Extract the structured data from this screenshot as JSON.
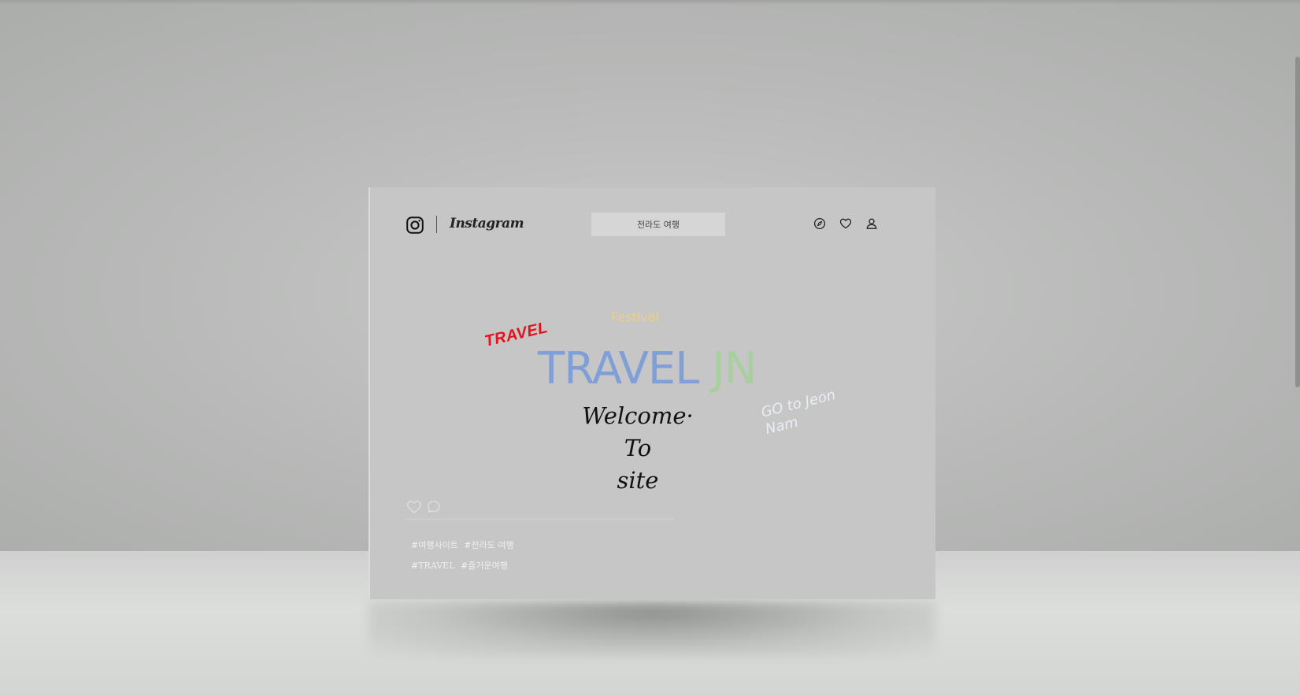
{
  "header": {
    "brand": "Instagram",
    "search": {
      "value": "전라도 여행",
      "placeholder": ""
    },
    "icons": [
      "compass-icon",
      "heart-icon",
      "user-icon"
    ]
  },
  "hero": {
    "festival": "Festival",
    "sticker": "TRAVEL",
    "title_part1": "TRAVEL",
    "title_part2": "JN",
    "go_note": "GO to Jeon Nam",
    "welcome_line1": "Welcome·",
    "welcome_line2": "To",
    "welcome_line3": "site"
  },
  "post": {
    "hashtags_row1": [
      "#여행사이트",
      "#전라도 여행"
    ],
    "hashtags_row2": [
      "#TRAVEL",
      "#즐거운여행"
    ]
  },
  "colors": {
    "card_bg": "#c6c6c6",
    "title_blue": "#7f9fd6",
    "title_green": "#a9cf9e",
    "festival": "#e8d08a",
    "sticker_red": "#e3121b"
  }
}
